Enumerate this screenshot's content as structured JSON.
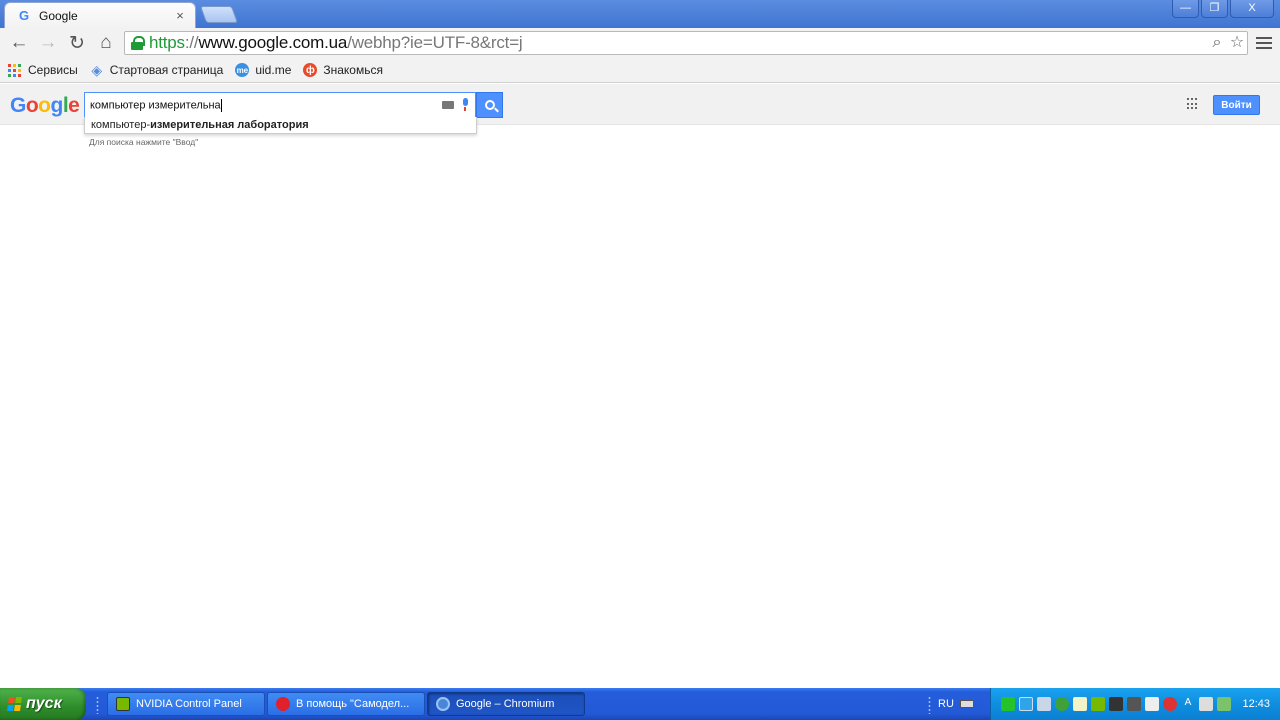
{
  "browser": {
    "tab_title": "Google",
    "tab_favicon": "G",
    "tab_close": "×",
    "window_controls": {
      "minimize": "—",
      "restore": "❐",
      "close": "X"
    },
    "url_scheme": "https",
    "url_sep": "://",
    "url_host": "www.google.com.ua",
    "url_path": "/webhp?ie=UTF-8&rct=j"
  },
  "bookmarks": [
    {
      "label": "Сервисы",
      "icon": "apps-grid-icon"
    },
    {
      "label": "Стартовая страница",
      "icon": "start-page-icon",
      "color": "#5b8bd6"
    },
    {
      "label": "uid.me",
      "icon": "uidme-icon",
      "color": "#3d8fe0",
      "glyph": "me"
    },
    {
      "label": "Знакомься",
      "icon": "znakomsya-icon",
      "color": "#e84a2a",
      "glyph": "ф"
    }
  ],
  "google": {
    "logo": [
      "G",
      "o",
      "o",
      "g",
      "l",
      "e"
    ],
    "logo_colors": [
      "#4285f4",
      "#ea4335",
      "#fbbc05",
      "#4285f4",
      "#34a853",
      "#ea4335"
    ],
    "query": "компьютер измерительна",
    "suggestion_prefix": "компьютер-",
    "suggestion_bold": "измерительная лаборатория",
    "hint": "Для поиска нажмите \"Ввод\"",
    "signin": "Войти"
  },
  "taskbar": {
    "start": "пуск",
    "tasks": [
      {
        "label": "NVIDIA Control Panel",
        "icon": "nvidia-icon",
        "color": "#76b900"
      },
      {
        "label": "В помощь \"Самодел...",
        "icon": "opera-icon",
        "color": "#e0202b"
      },
      {
        "label": "Google – Chromium",
        "icon": "chromium-icon",
        "color": "#4a86d8"
      }
    ],
    "language": "RU",
    "clock": "12:43"
  }
}
